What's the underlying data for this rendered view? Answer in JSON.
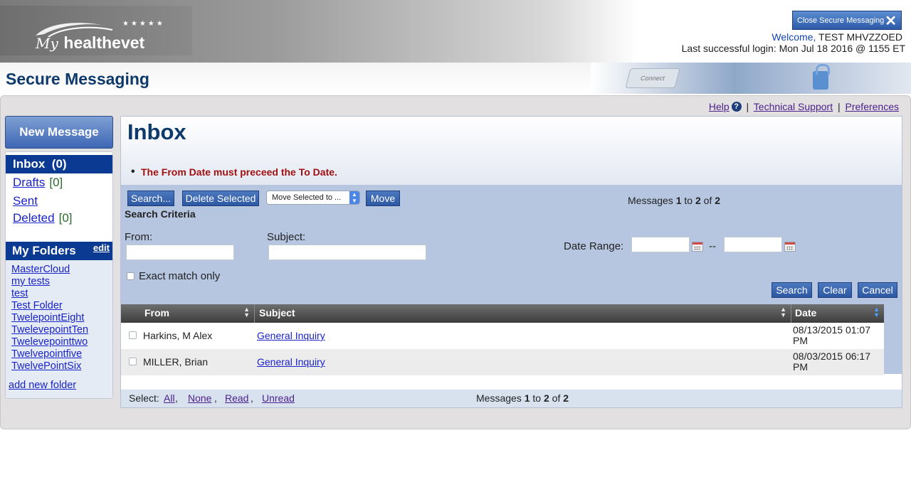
{
  "header": {
    "logo_my": "My",
    "logo_brand": "healthevet",
    "close_label": "Close Secure Messaging",
    "welcome_word": "Welcome,",
    "user_name": " TEST MHVZZOED",
    "last_login": "Last successful login: Mon Jul 18 2016 @ 1155 ET"
  },
  "title": "Secure Messaging",
  "banner_key_text": "Connect",
  "top_links": {
    "help": "Help",
    "help_icon": "?",
    "support": "Technical Support",
    "preferences": "Preferences",
    "separator": "|"
  },
  "sidebar": {
    "new_message": "New Message",
    "inbox_label": "Inbox",
    "inbox_count": "(0)",
    "drafts_label": "Drafts",
    "drafts_count": "[0]",
    "sent_label": "Sent",
    "deleted_label": "Deleted",
    "deleted_count": "[0]",
    "folders_title": "My Folders",
    "edit_label": "edit",
    "folders": [
      "MasterCloud",
      "my tests",
      "test",
      "Test Folder",
      "TwelepointEight",
      "TwelevepointTen",
      "Twelevepointtwo",
      "Twelvepointfive",
      "TwelvePointSix"
    ],
    "add_folder": "add new folder"
  },
  "main": {
    "title": "Inbox",
    "error": "The From Date must preceed the To Date.",
    "toolbar": {
      "search": "Search...",
      "delete": "Delete Selected",
      "move_select": "Move Selected to ...",
      "move": "Move"
    },
    "count": {
      "prefix": "Messages ",
      "from": "1",
      "to_word": " to ",
      "to": "2",
      "of_word": " of ",
      "total": "2"
    },
    "search": {
      "criteria_title": "Search Criteria",
      "from_label": "From:",
      "subject_label": "Subject:",
      "date_range_label": "Date Range:",
      "date_sep": "--",
      "exact_label": "Exact match only",
      "search_btn": "Search",
      "clear_btn": "Clear",
      "cancel_btn": "Cancel"
    },
    "table": {
      "columns": [
        "From",
        "Subject",
        "Date"
      ],
      "rows": [
        {
          "from": "Harkins, M Alex",
          "subject": "General Inquiry ",
          "date_line1": "08/13/2015 01:07",
          "date_line2": "PM"
        },
        {
          "from": "MILLER, Brian",
          "subject": "General Inquiry ",
          "date_line1": "08/03/2015 06:17",
          "date_line2": "PM"
        }
      ]
    },
    "footer": {
      "select_label": "Select:",
      "all": "All",
      "none": "None",
      "read": "Read",
      "unread": "Unread",
      "comma": ","
    }
  },
  "colors": {
    "nav_blue": "#0b3a92",
    "title_blue": "#0e3a6b",
    "error_red": "#a01010",
    "button_blue": "#2d58a3",
    "search_bg": "#b6c6e0"
  }
}
